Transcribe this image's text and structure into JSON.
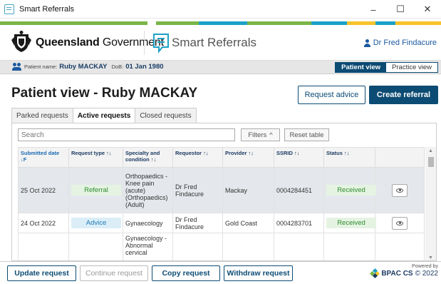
{
  "window": {
    "title": "Smart Referrals",
    "controls": {
      "minimize": "–",
      "maximize": "☐",
      "close": "✕"
    }
  },
  "brand": {
    "government_bold": "Queensland",
    "government_rest": " Government",
    "app_name": "Smart Referrals",
    "user_name": "Dr Fred Findacure",
    "stripe_colors": [
      "#7ab648",
      "#ffffff",
      "#7ab648",
      "#1ba2c8",
      "#7ab648",
      "#1ba2c8",
      "#f9c32b",
      "#1ba2c8",
      "#f9c32b"
    ]
  },
  "patient": {
    "name_label": "Patient name:",
    "name": "Ruby MACKAY",
    "dob_label": "DoB:",
    "dob": "01 Jan 1980"
  },
  "view_toggle": {
    "patient_view": "Patient view",
    "practice_view": "Practice view"
  },
  "page": {
    "title": "Patient view - Ruby MACKAY",
    "request_advice": "Request advice",
    "create_referral": "Create referral"
  },
  "tabs": [
    {
      "label": "Parked requests"
    },
    {
      "label": "Active requests"
    },
    {
      "label": "Closed requests"
    }
  ],
  "toolbar": {
    "search_placeholder": "Search",
    "filters_label": "Filters",
    "filters_arrow": "^",
    "reset_label": "Reset table"
  },
  "table": {
    "headers": [
      "Submitted date ↓F",
      "Request type ↑↓",
      "Specialty and condition ↑↓",
      "Requestor ↑↓",
      "Provider ↑↓",
      "SSRID ↑↓",
      "Status ↑↓",
      ""
    ],
    "rows": [
      {
        "date": "25 Oct 2022",
        "type": "Referral",
        "specialty": "Orthopaedics - Knee pain (acute) (Orthopaedics) (Adult)",
        "requestor": "Dr Fred Findacure",
        "provider": "Mackay",
        "ssrid": "0004284451",
        "status": "Received"
      },
      {
        "date": "24 Oct 2022",
        "type": "Advice",
        "specialty": "Gynaecology",
        "requestor": "Dr Fred Findacure",
        "provider": "Gold Coast",
        "ssrid": "0004283701",
        "status": "Received"
      },
      {
        "date": "",
        "type": "",
        "specialty": "Gynaecology - Abnormal cervical",
        "requestor": "",
        "provider": "",
        "ssrid": "",
        "status": ""
      }
    ]
  },
  "footer": {
    "update_request": "Update request",
    "continue_request": "Continue request",
    "copy_request": "Copy request",
    "withdraw_request": "Withdraw request",
    "powered_by": "Powered by",
    "powered_brand": "BPAC CS",
    "powered_year": "© 2022"
  },
  "colors": {
    "primary": "#0c4b73",
    "referral_badge": "#e5f4e2",
    "advice_badge": "#dbeef8",
    "selected_row": "#e4e8ec"
  }
}
